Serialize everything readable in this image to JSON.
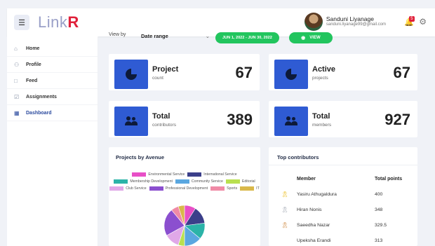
{
  "app": {
    "logo_a": "Link",
    "logo_b": "R"
  },
  "header": {
    "user_name": "Sanduni Liyanage",
    "user_email": "sanduni.liyanage99@gmail.com",
    "notification_count": "5"
  },
  "sidebar": {
    "items": [
      {
        "label": "Home",
        "icon": "home-icon"
      },
      {
        "label": "Profile",
        "icon": "user-icon"
      },
      {
        "label": "Feed",
        "icon": "chat-icon"
      },
      {
        "label": "Assignments",
        "icon": "checklist-icon"
      },
      {
        "label": "Dashboard",
        "icon": "grid-icon"
      }
    ],
    "active": "Dashboard"
  },
  "filters": {
    "view_by_label": "View by",
    "selected": "Date range",
    "date_range": "JUN 1, 2022 - JUN 30, 2022",
    "view_button": "VIEW"
  },
  "stats": {
    "project_count": {
      "title": "Project",
      "subtitle": "count",
      "value": "67"
    },
    "active_projects": {
      "title": "Active",
      "subtitle": "projects",
      "value": "67"
    },
    "total_contributors": {
      "title": "Total",
      "subtitle": "contributors",
      "value": "389"
    },
    "total_members": {
      "title": "Total",
      "subtitle": "members",
      "value": "927"
    }
  },
  "avenue_panel": {
    "title": "Projects by Avenue",
    "legend": [
      {
        "label": "Environmental Service",
        "color": "#e84fc7"
      },
      {
        "label": "International Service",
        "color": "#3b3f8a"
      },
      {
        "label": "Membership Development",
        "color": "#2bb3a8"
      },
      {
        "label": "Community Service",
        "color": "#5aa7e0"
      },
      {
        "label": "Editorial",
        "color": "#b9e04f"
      },
      {
        "label": "Club Service",
        "color": "#e0a8e8"
      },
      {
        "label": "Professional Development",
        "color": "#8b4fcf"
      },
      {
        "label": "Sports",
        "color": "#f08aa6"
      },
      {
        "label": "IT",
        "color": "#d9b84a"
      }
    ]
  },
  "chart_data": {
    "type": "pie",
    "title": "Projects by Avenue",
    "labels": [
      "Environmental Service",
      "International Service",
      "Membership Development",
      "Community Service",
      "Editorial",
      "Club Service",
      "Professional Development",
      "Sports",
      "IT"
    ],
    "values": [
      9,
      14,
      13,
      14,
      5,
      12,
      22,
      6,
      5
    ],
    "colors": [
      "#e84fc7",
      "#3b3f8a",
      "#2bb3a8",
      "#5aa7e0",
      "#b9e04f",
      "#e0a8e8",
      "#8b4fcf",
      "#f08aa6",
      "#d9b84a"
    ],
    "legend": "top"
  },
  "contributors": {
    "title": "Top contributors",
    "col_member": "Member",
    "col_points": "Total points",
    "rows": [
      {
        "name": "Yasiru Athugaldura",
        "points": "400",
        "medal_color": "#e8b400"
      },
      {
        "name": "Hiran Nonis",
        "points": "348",
        "medal_color": "#9aa0ad"
      },
      {
        "name": "Saeedha Nazar",
        "points": "329.5",
        "medal_color": "#c87b2a"
      },
      {
        "name": "Upeksha Erandi",
        "points": "313",
        "medal_color": ""
      }
    ]
  }
}
